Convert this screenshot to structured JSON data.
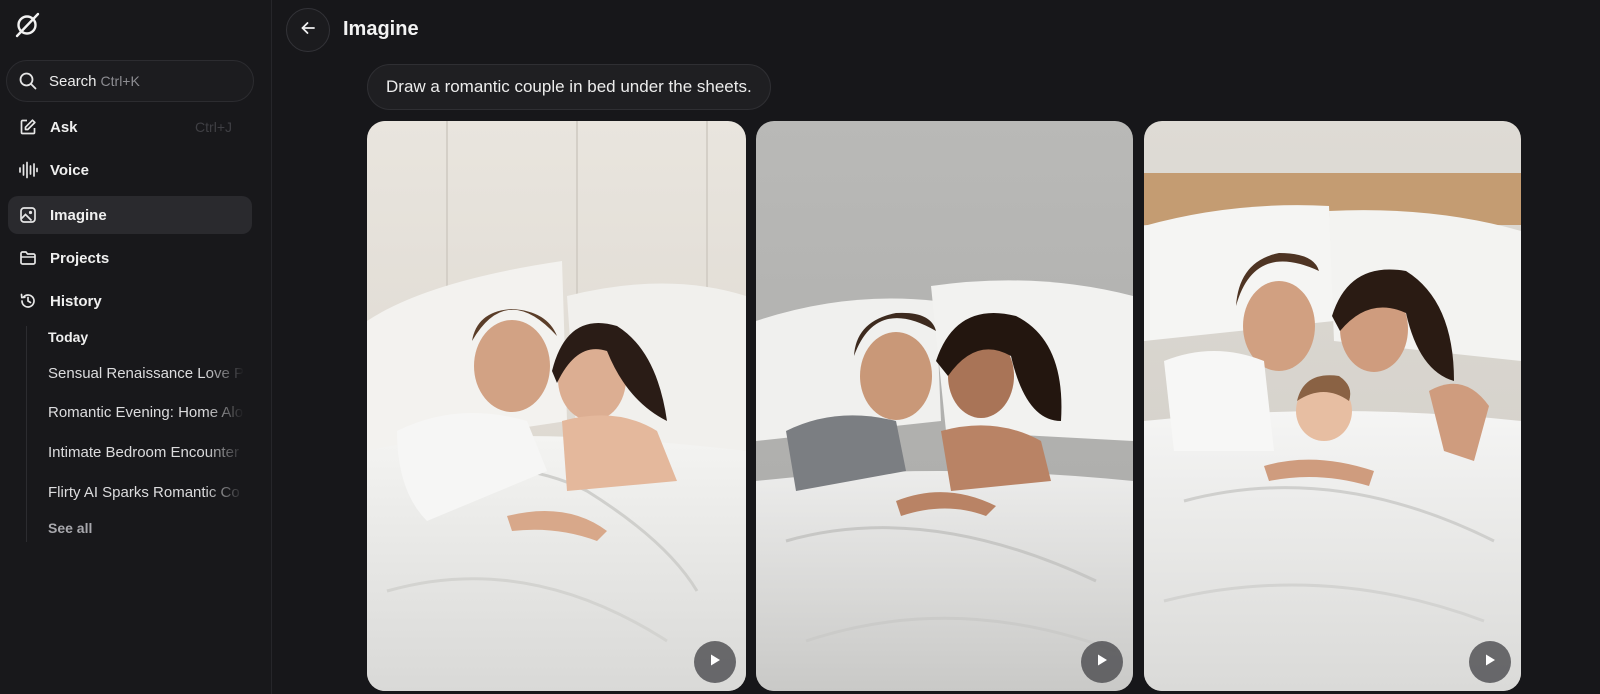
{
  "sidebar": {
    "logo_icon": "grok-logo-icon",
    "search": {
      "label": "Search",
      "shortcut": "Ctrl+K"
    },
    "nav": [
      {
        "id": "ask",
        "label": "Ask",
        "icon": "pencil-square-icon",
        "shortcut": "Ctrl+J"
      },
      {
        "id": "voice",
        "label": "Voice",
        "icon": "waveform-icon"
      },
      {
        "id": "imagine",
        "label": "Imagine",
        "icon": "image-icon",
        "active": true
      },
      {
        "id": "projects",
        "label": "Projects",
        "icon": "folder-icon"
      },
      {
        "id": "history",
        "label": "History",
        "icon": "history-icon"
      }
    ],
    "history": {
      "section_label": "Today",
      "items": [
        "Sensual Renaissance Love P",
        "Romantic Evening: Home Alo",
        "Intimate Bedroom Encounter",
        "Flirty AI Sparks Romantic Co"
      ],
      "see_all": "See all"
    }
  },
  "header": {
    "title": "Imagine",
    "back_icon": "arrow-left-icon"
  },
  "prompt": "Draw a romantic couple in bed under the sheets.",
  "images": [
    {
      "alt": "generated-image-1",
      "play_icon": "play-icon"
    },
    {
      "alt": "generated-image-2",
      "play_icon": "play-icon"
    },
    {
      "alt": "generated-image-3",
      "play_icon": "play-icon"
    }
  ],
  "colors": {
    "background": "#17171a",
    "sidebar_active": "#2a2a2e",
    "text": "#e9e9ea"
  }
}
